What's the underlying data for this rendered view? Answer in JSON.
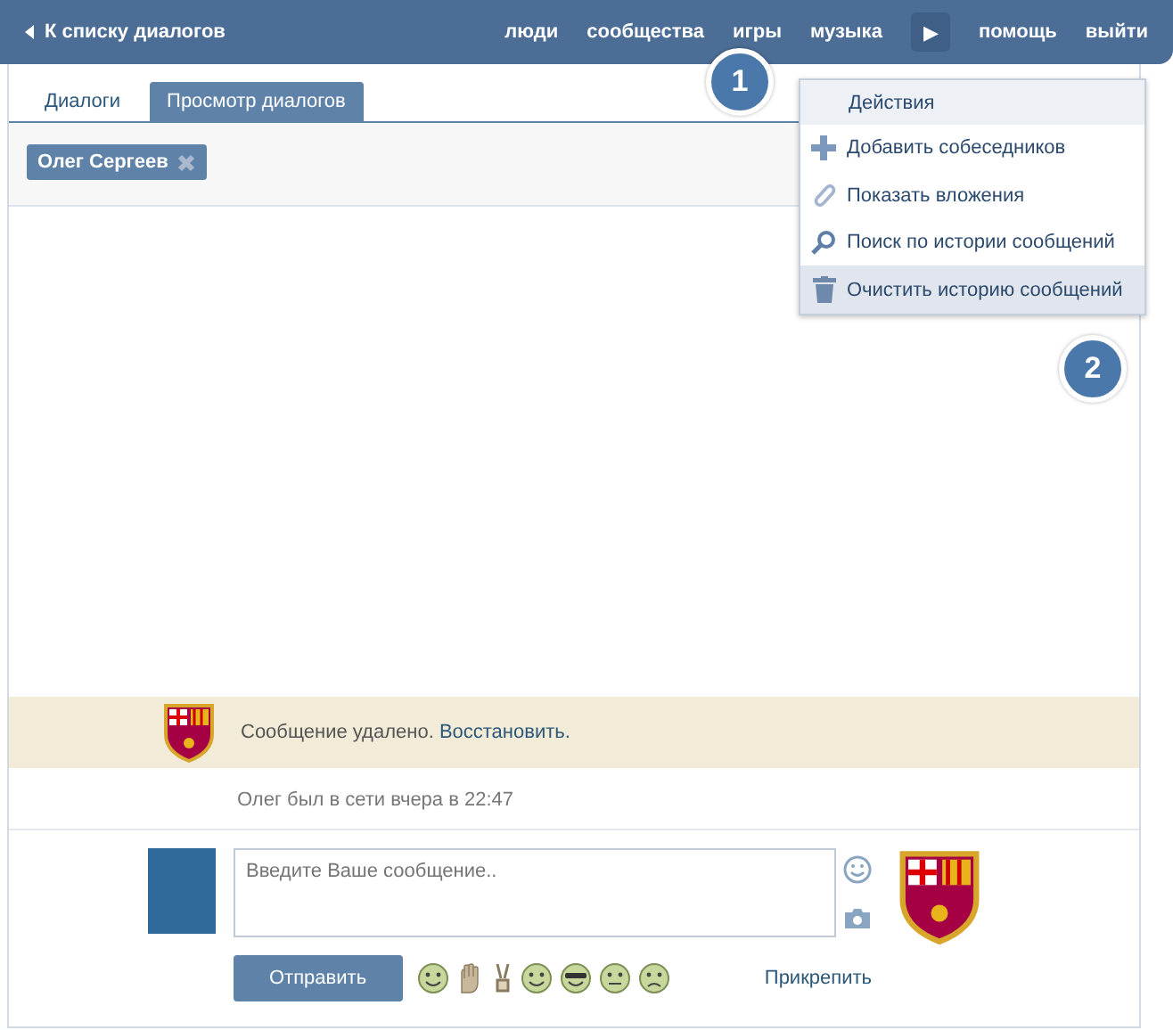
{
  "top_bar": {
    "back_link": "К списку диалогов",
    "nav": [
      "люди",
      "сообщества",
      "игры",
      "музыка"
    ],
    "more_button": "▶",
    "nav_right": [
      "помощь",
      "выйти"
    ]
  },
  "tabs": [
    {
      "label": "Диалоги",
      "selected": false
    },
    {
      "label": "Просмотр диалогов",
      "selected": true
    }
  ],
  "participants": [
    {
      "name": "Олег Сергеев"
    }
  ],
  "actions_menu": {
    "title": "Действия",
    "items": [
      {
        "kind": "add",
        "label": "Добавить собеседников",
        "selected": false
      },
      {
        "kind": "attachments",
        "label": "Показать вложения",
        "selected": false
      },
      {
        "kind": "search",
        "label": "Поиск по истории сообщений",
        "selected": false
      },
      {
        "kind": "clear",
        "label": "Очистить историю сообщений",
        "selected": true
      }
    ]
  },
  "callouts": [
    "1",
    "2"
  ],
  "deleted_message": {
    "text": "Сообщение удалено.",
    "restore_link": "Восстановить."
  },
  "last_seen": "Олег был в сети вчера в 22:47",
  "composer": {
    "placeholder": "Введите Ваше сообщение..",
    "send_button": "Отправить",
    "attach_link": "Прикрепить",
    "emojis": [
      {
        "kind": "rolleyes"
      },
      {
        "kind": "hand"
      },
      {
        "kind": "victory"
      },
      {
        "kind": "laugh"
      },
      {
        "kind": "cool"
      },
      {
        "kind": "neutral"
      },
      {
        "kind": "sad"
      }
    ]
  }
}
